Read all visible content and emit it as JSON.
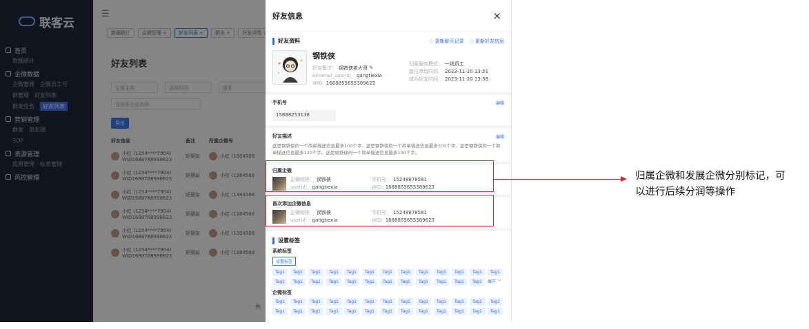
{
  "app": {
    "brand": "联客云",
    "nav": [
      {
        "group": "首页",
        "subs": [
          "数据统计"
        ]
      },
      {
        "group": "企微数据",
        "subs": [
          "企微管理",
          "企微员工号",
          "群管理",
          "好友列表",
          "群发任务",
          "好友列表"
        ]
      },
      {
        "group": "营销管理",
        "subs": [
          "群发",
          "朋友圈",
          "SOP"
        ]
      },
      {
        "group": "资源管理",
        "subs": [
          "应用管理",
          "标签管理"
        ]
      },
      {
        "group": "风控管理",
        "subs": []
      }
    ],
    "chips": [
      "数据统计",
      "企微管理 ×",
      "好友列表 ×",
      "群发 ×",
      "好友详情 ×"
    ],
    "page_title": "好友列表",
    "filters": [
      "企微主体",
      "选择时间",
      "搜索"
    ],
    "search_placeholder": "请搜索企业名称",
    "export_label": "导出",
    "table_headers": [
      "好友信息",
      "备注",
      "所属企微号"
    ],
    "rows": [
      {
        "name": "小红 (1254****7954)",
        "wid": "WID1688788998623",
        "note": "好朋友",
        "corp": "小红 (1384568"
      },
      {
        "name": "小红 (1254****7954)",
        "wid": "WID1688788998623",
        "note": "好朋友",
        "corp": "小红 (1384568"
      },
      {
        "name": "小红 (1254****7954)",
        "wid": "WID1688788998623",
        "note": "好朋友",
        "corp": "小红 (1384568"
      },
      {
        "name": "小红 (1254****7954)",
        "wid": "WID1688788998623",
        "note": "好朋友",
        "corp": "小红 (1384568"
      },
      {
        "name": "小红 (1254****7954)",
        "wid": "WID1688788998623",
        "note": "好朋友",
        "corp": "小红 (1384568"
      },
      {
        "name": "小红 (1254****7954)",
        "wid": "WID1688788998623",
        "note": "好朋友",
        "corp": "小红 (1384568"
      }
    ],
    "pager": "共"
  },
  "drawer": {
    "title": "好友信息",
    "close": "×",
    "profile": {
      "title": "好友资料",
      "link_update_chat": "◌ 更新聊天记录",
      "link_update_info": "◌ 更新好友信息",
      "nickname": "钢铁侠",
      "remark_key": "好友备注：",
      "remark_value": "钢铁侠老大哥",
      "userid_key": "external_userid：",
      "userid_value": "gangtiexia",
      "wid_key": "WID:",
      "wid_value": "1688855655389623",
      "service_key": "归属服务模式：",
      "service_value": "一线员工",
      "first_add_key": "首拉添加时间：",
      "first_add_value": "2023-11-20 13:51",
      "friend_time_key": "成为好友时间：",
      "friend_time_value": "2023-11-20 13:58"
    },
    "phone": {
      "title": "手机号",
      "edit": "编辑",
      "value": "15888253138"
    },
    "description": {
      "title": "好友描述",
      "edit": "编辑",
      "text": "这是钢铁侠的一个简单描述信息最多100个字。这是钢铁侠的一个简单描述信息最多100个字。这是钢铁侠的一个简单描述信息最多120个字。这是钢铁侠的一个简单描述信息最多100个字。"
    },
    "owner_company": {
      "title": "归属企微",
      "nick_key": "企微昵称：",
      "nick_value": "钢铁侠",
      "userid_key": "userid：",
      "userid_value": "gangtiexia",
      "phone_key": "手机号：",
      "phone_value": "15248878581",
      "wid_key": "WID:",
      "wid_value": "1688855655389623"
    },
    "first_company": {
      "title": "首次添加企微信息",
      "nick_key": "企微昵称：",
      "nick_value": "钢铁侠",
      "userid_key": "userid：",
      "userid_value": "gangtiexia",
      "phone_key": "手机号：",
      "phone_value": "15248878581",
      "wid_key": "WID:",
      "wid_value": "1688855655389623"
    },
    "tags": {
      "title": "设置标签",
      "system_title": "系统标签",
      "set_button": "设置标签",
      "tag_label": "Tag1",
      "expand": "展开 ﹀",
      "corp_title": "企微标签"
    }
  },
  "annotation": {
    "text": "归属企微和发展企微分别标记，可以进行后续分润等操作",
    "color": "#d9232d"
  }
}
